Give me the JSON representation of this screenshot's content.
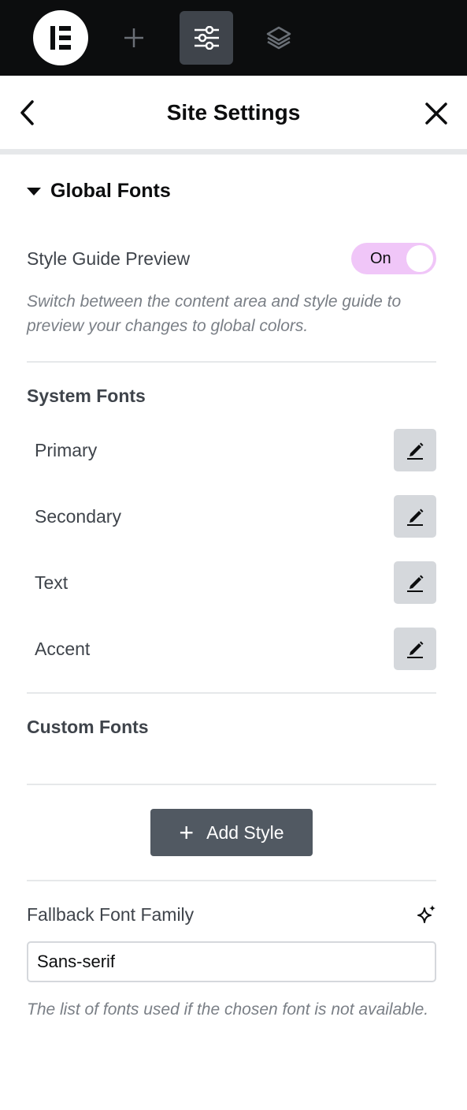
{
  "toolbar": {
    "logo": "elementor-logo-icon",
    "buttons": [
      "add-element-icon",
      "site-settings-icon",
      "structure-layers-icon"
    ],
    "active": "site-settings-icon"
  },
  "header": {
    "title": "Site Settings",
    "back_icon": "chevron-left-icon",
    "close_icon": "close-icon"
  },
  "section": {
    "title": "Global Fonts",
    "expanded": true
  },
  "style_guide": {
    "label": "Style Guide Preview",
    "toggle_label": "On",
    "toggle_state": true,
    "help": "Switch between the content area and style guide to preview your changes to global colors."
  },
  "system_fonts": {
    "title": "System Fonts",
    "items": [
      {
        "label": "Primary"
      },
      {
        "label": "Secondary"
      },
      {
        "label": "Text"
      },
      {
        "label": "Accent"
      }
    ]
  },
  "custom_fonts": {
    "title": "Custom Fonts"
  },
  "add_style": {
    "icon": "+",
    "label": "Add Style"
  },
  "fallback": {
    "label": "Fallback Font Family",
    "ai_icon": "sparkles-icon",
    "value": "Sans-serif",
    "help": "The list of fonts used if the chosen font is not available."
  },
  "colors": {
    "topbar": "#0c0d0e",
    "toggle_on": "#f0c6f8",
    "edit_button": "#d5d8dc",
    "add_button": "#515962"
  }
}
